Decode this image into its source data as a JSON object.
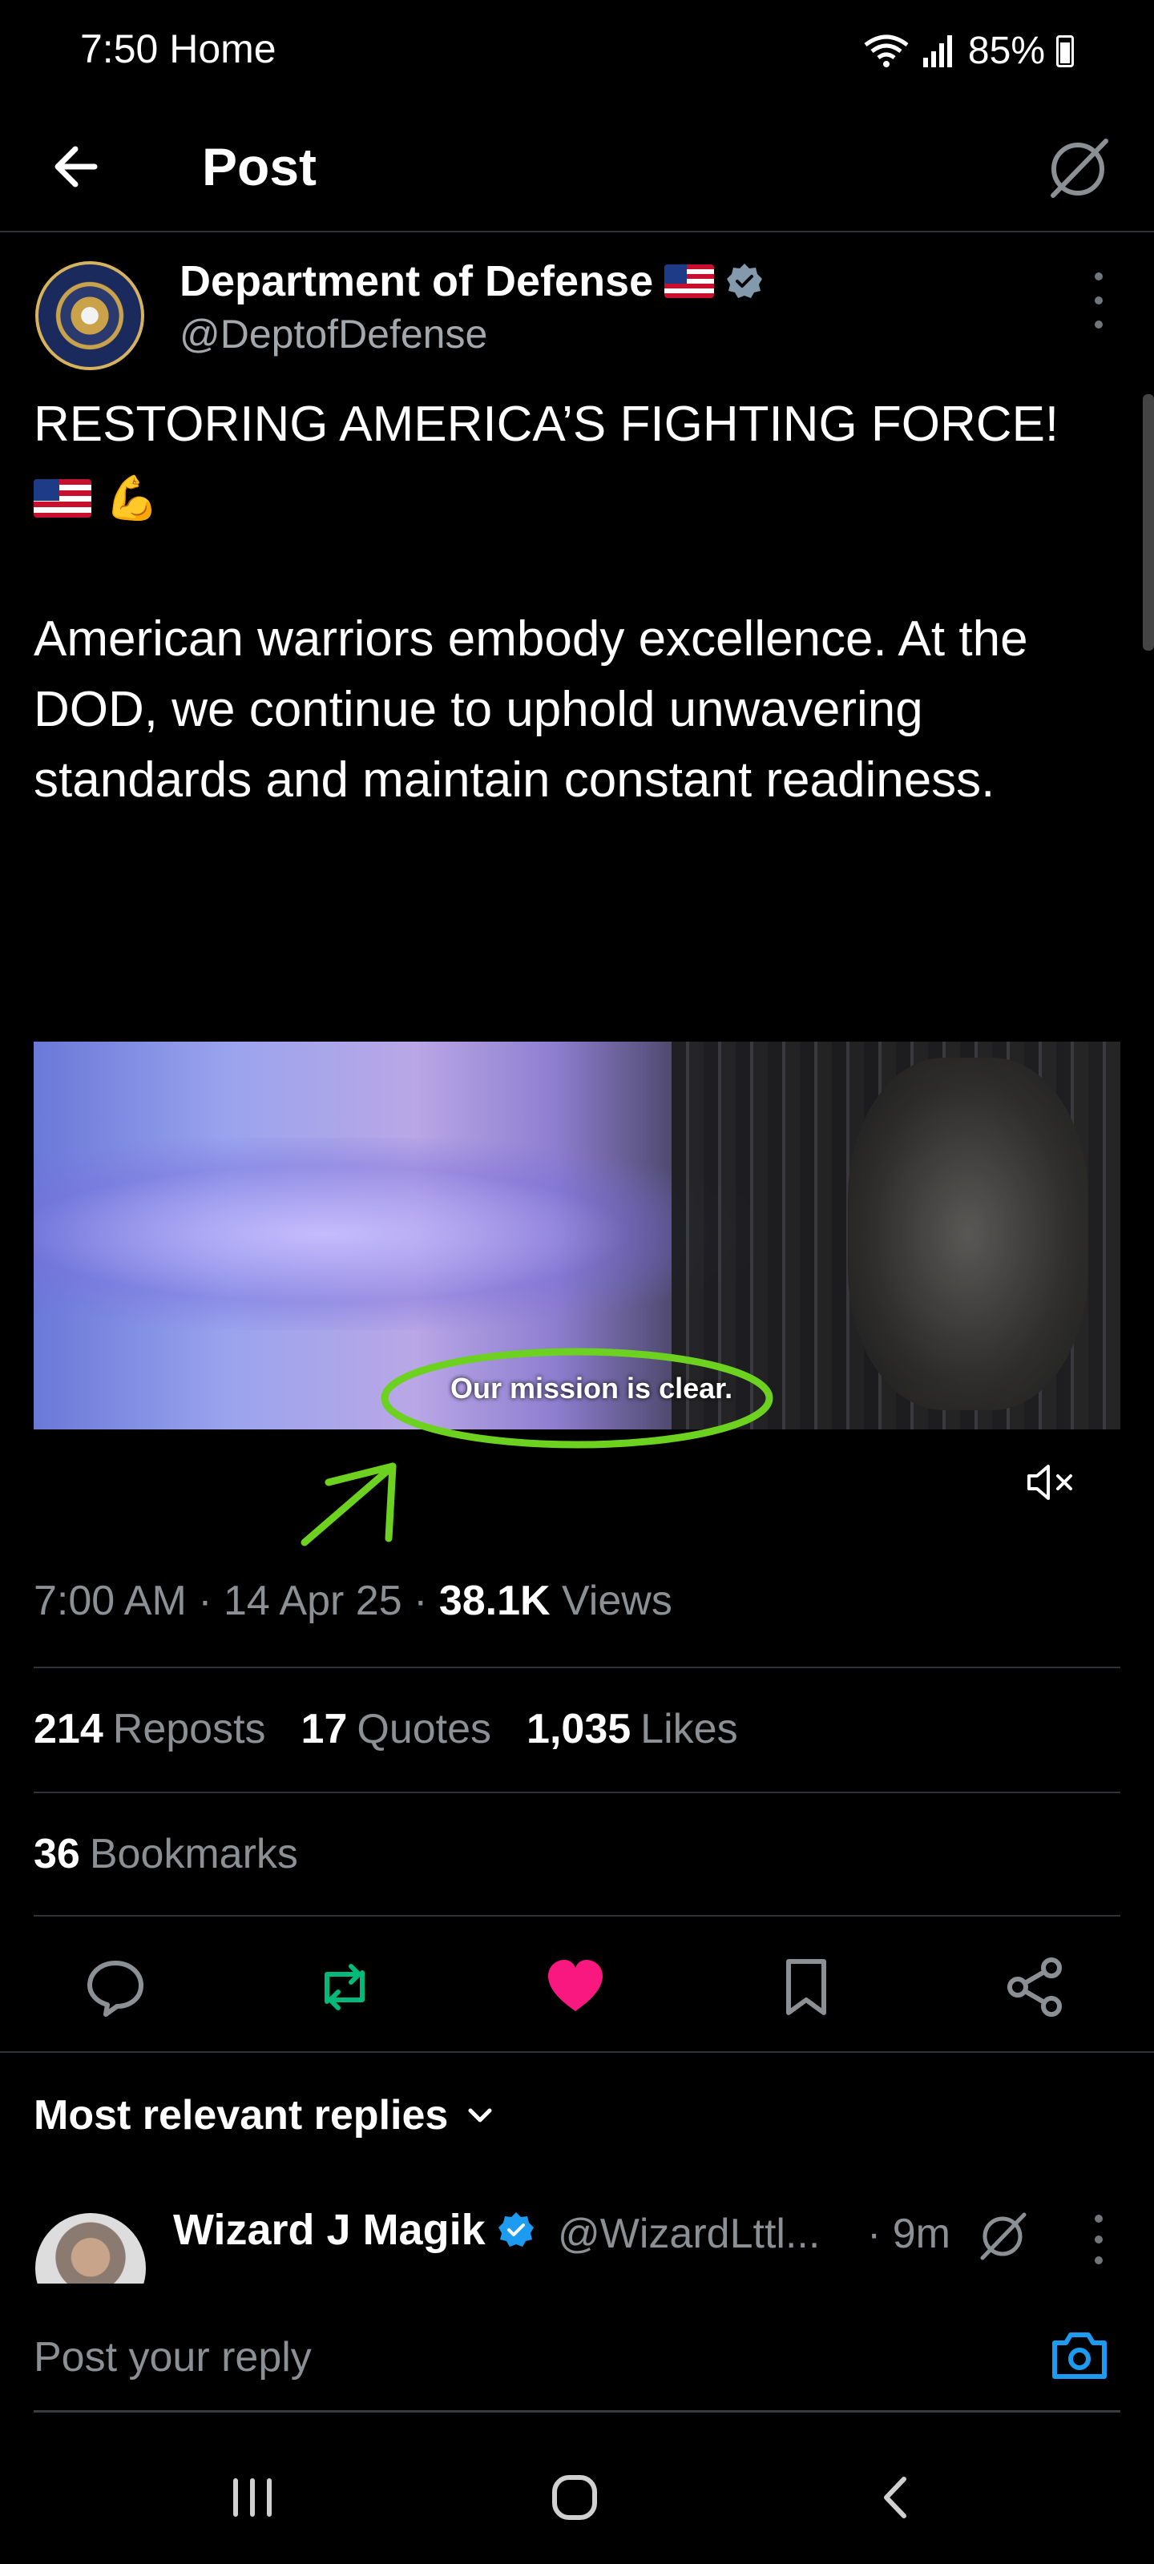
{
  "status_bar": {
    "time": "7:50",
    "carrier": "Home",
    "battery": "85%"
  },
  "top_bar": {
    "title": "Post"
  },
  "post": {
    "author_name": "Department of Defense",
    "author_handle": "@DeptofDefense",
    "headline": "RESTORING AMERICA’S FIGHTING FORCE!",
    "body": "American warriors embody excellence. At the DOD, we continue to uphold unwavering standards and maintain constant readiness.",
    "video_caption": "Our mission is clear.",
    "timestamp": "7:00 AM · 14 Apr 25 · ",
    "views_count": "38.1K",
    "views_label": " Views"
  },
  "stats": {
    "reposts_count": "214",
    "reposts_label": "Reposts",
    "quotes_count": "17",
    "quotes_label": "Quotes",
    "likes_count": "1,035",
    "likes_label": "Likes",
    "bookmarks_count": "36",
    "bookmarks_label": "Bookmarks"
  },
  "replies": {
    "sort_label": "Most relevant replies",
    "first_reply": {
      "name": "Wizard J Magik",
      "handle": "@WizardLttl...",
      "time": "· 9m"
    }
  },
  "composer": {
    "placeholder": "Post your reply"
  },
  "colors": {
    "background": "#000000",
    "text": "#e7e9ea",
    "muted": "#8b9095",
    "verified_gray": "#829aab",
    "verified_blue": "#1d9bf0",
    "repost_green": "#00ba7c",
    "like_pink": "#f91880",
    "annotation_green": "#6cd11f"
  },
  "icons": [
    "back-arrow-icon",
    "grok-icon",
    "verified-badge-icon",
    "more-icon",
    "mute-icon",
    "reply-icon",
    "repost-icon",
    "like-icon",
    "bookmark-icon",
    "share-icon",
    "chevron-down-icon",
    "camera-icon",
    "recents-icon",
    "home-icon",
    "nav-back-icon"
  ]
}
